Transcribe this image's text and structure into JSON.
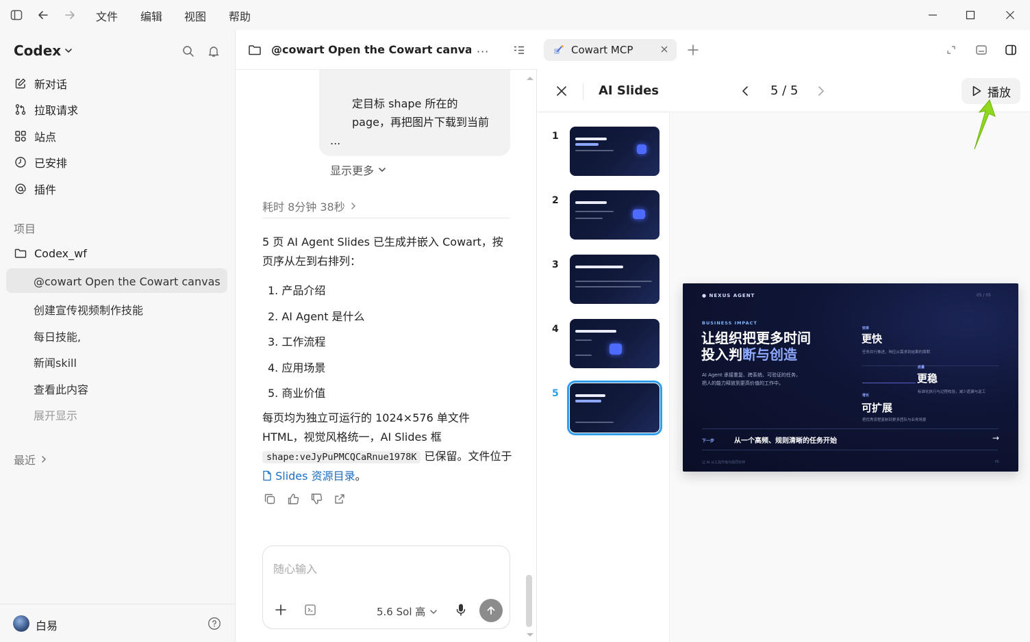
{
  "titlebar": {
    "menus": [
      "文件",
      "编辑",
      "视图",
      "帮助"
    ]
  },
  "sidebar": {
    "brand": "Codex",
    "items": [
      {
        "label": "新对话",
        "icon": "edit-icon"
      },
      {
        "label": "拉取请求",
        "icon": "pull-request-icon"
      },
      {
        "label": "站点",
        "icon": "grid-icon"
      },
      {
        "label": "已安排",
        "icon": "clock-icon"
      },
      {
        "label": "插件",
        "icon": "at-icon"
      }
    ],
    "projects_label": "项目",
    "project": "Codex_wf",
    "threads": [
      "@cowart Open the Cowart canvas f",
      "创建宣传视频制作技能",
      "每日技能,",
      "新闻skill",
      "查看此内容"
    ],
    "expand_label": "展开显示",
    "recent_label": "最近",
    "user_name": "白易"
  },
  "chat": {
    "title": "@cowart Open the Cowart canvas fo",
    "bubble_lines": [
      "定目标 shape 所在的",
      "page，再把图片下载到当前",
      "..."
    ],
    "show_more": "显示更多",
    "elapsed": "耗时 8分钟 38秒",
    "summary": "5 页 AI Agent Slides 已生成并嵌入 Cowart，按页序从左到右排列：",
    "list": [
      "1. 产品介绍",
      "2. AI Agent 是什么",
      "3. 工作流程",
      "4. 应用场景",
      "5. 商业价值"
    ],
    "para_prefix": "每页均为独立可运行的 1024×576 单文件 HTML，视觉风格统一，AI Slides 框",
    "para_code": "shape:veJyPuPMCQCaRnue1978K",
    "para_mid": "已保留。文件位于",
    "para_link": "Slides 资源目录",
    "para_end": "。",
    "composer_placeholder": "随心输入",
    "model": "5.6 Sol 高"
  },
  "right": {
    "tab_label": "Cowart MCP",
    "slides_title": "AI Slides",
    "page_indicator": "5 / 5",
    "play_label": "播放",
    "thumb_numbers": [
      "1",
      "2",
      "3",
      "4",
      "5"
    ],
    "slide": {
      "brand": "● NEXUS AGENT",
      "page": "05 / 05",
      "kicker": "BUSINESS IMPACT",
      "headline_1": "让组织把更多时间",
      "headline_2a": "投入判",
      "headline_2b": "断与创造",
      "sub_1": "AI Agent 承接重复、跨系统、可验证的任务，",
      "sub_2": "把人的能力释放到更高价值的工作中。",
      "col1_mini": "效率",
      "col1": "更快",
      "col1_desc": "任务并行推进，响应从需求到结果的周期",
      "col2_mini": "质量",
      "col2": "更稳",
      "col2_desc": "标准化执行与过程校验，减少遗漏与返工",
      "col3_mini": "增长",
      "col3": "可扩展",
      "col3_desc": "把优秀流程复制到更多团队与业务场景",
      "next_label": "下一步",
      "footer_line": "从一个高频、规则清晰的任务开始",
      "caption": "让 AI 从工具升级为协同伙伴",
      "page_short": "05"
    }
  },
  "colors": {
    "accent": "#2f9ee8",
    "link": "#1a6ec2",
    "arrow": "#8fd81c"
  }
}
